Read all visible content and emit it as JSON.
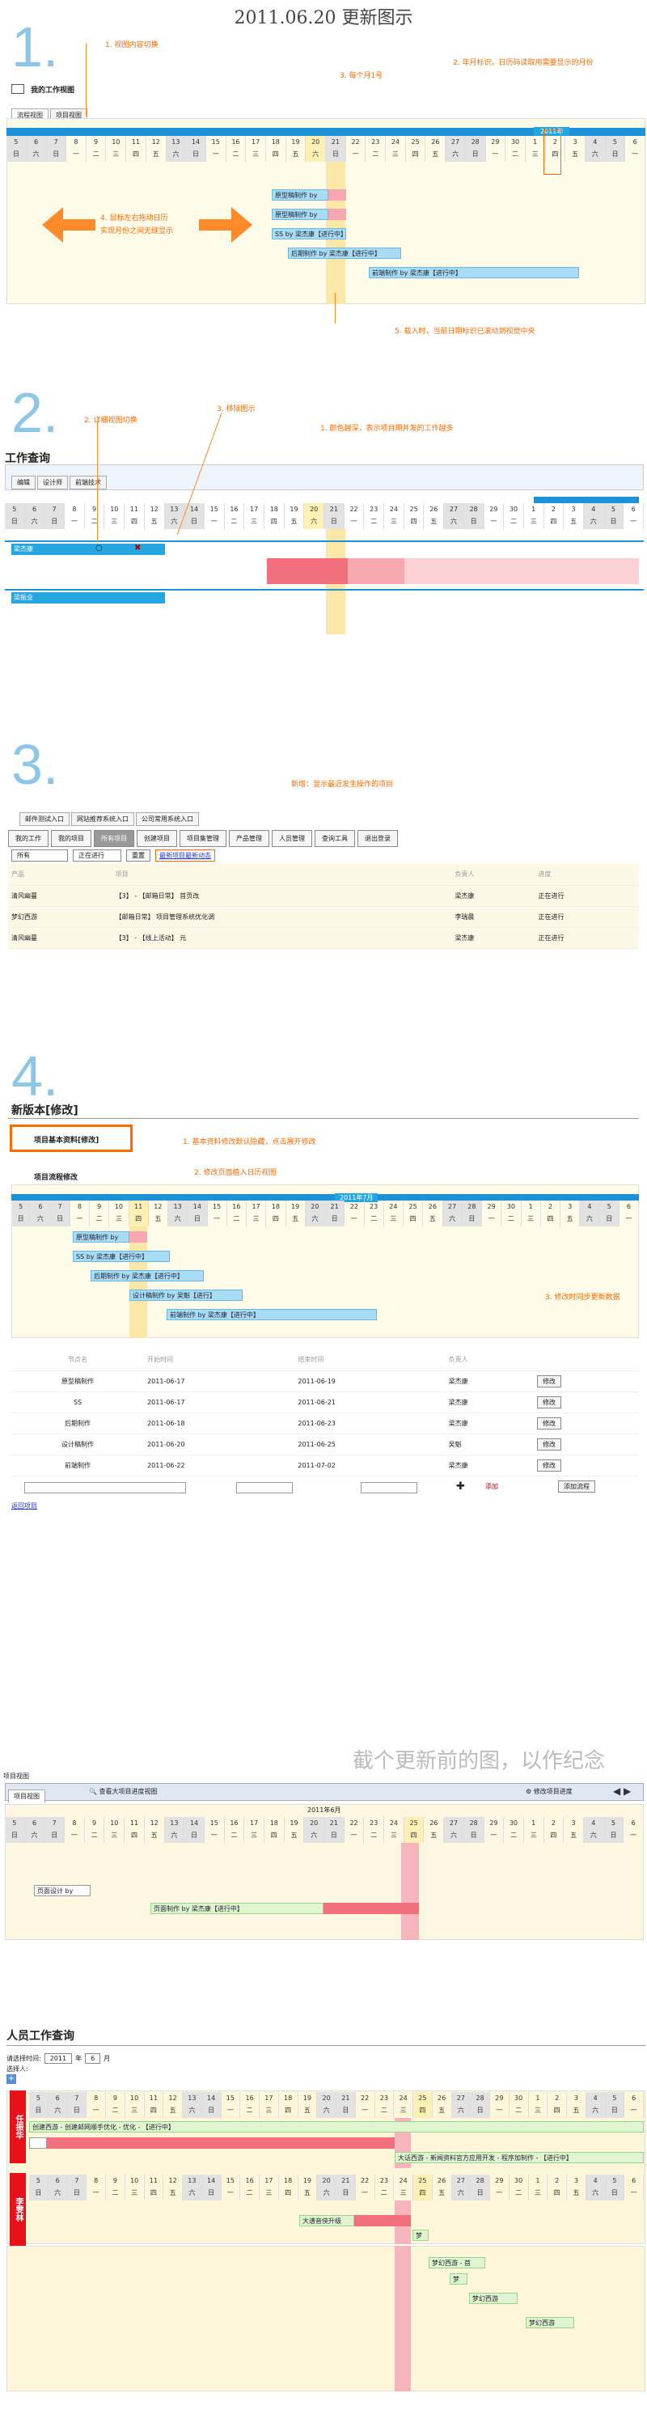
{
  "page_title": "2011.06.20 更新图示",
  "s1": {
    "num": "1.",
    "heading": "我的工作视图",
    "tabs": [
      "流程视图",
      "项目视图"
    ],
    "month_label": "2011年",
    "ann1": "1. 视图内容切换",
    "ann2": "2. 年月标识，日历码读取用需要显示的月份",
    "ann3": "3. 每个月1号",
    "ann4a": "4. 鼠标左右拖动日历",
    "ann4b": "实现月份之间无缝显示",
    "ann5": "5. 载入时，当前日期标识已滚动到视觉中央",
    "days": [
      "5",
      "6",
      "7",
      "8",
      "9",
      "10",
      "11",
      "12",
      "13",
      "14",
      "15",
      "16",
      "17",
      "18",
      "19",
      "20",
      "21",
      "22",
      "23",
      "24",
      "25",
      "26",
      "27",
      "28",
      "29",
      "30",
      "1",
      "2",
      "3",
      "4",
      "5",
      "6"
    ],
    "weekdays": [
      "日",
      "六",
      "日",
      "一",
      "二",
      "三",
      "四",
      "五",
      "六",
      "日",
      "一",
      "二",
      "三",
      "四",
      "五",
      "六",
      "日",
      "一",
      "二",
      "三",
      "四",
      "五",
      "六",
      "日",
      "一",
      "二",
      "三",
      "四",
      "五",
      "六",
      "日",
      "一"
    ],
    "bars": [
      "原型稿制作 by",
      "原型稿制作 by",
      "SS by 梁杰康【进行中】",
      "后期制作 by 梁杰康【进行中】",
      "前端制作 by 梁杰康【进行中】"
    ]
  },
  "s2": {
    "num": "2.",
    "heading": "工作查询",
    "tabs": [
      "编辑",
      "设计师",
      "前端技术"
    ],
    "ann1": "2. 详细视图切换",
    "ann2": "3. 移除图示",
    "ann3": "1. 颜色越深，表示项目期并发的工作越多",
    "rows": [
      "梁杰康",
      "梁振业"
    ]
  },
  "s3": {
    "num": "3.",
    "toptabs": [
      "邮件测试入口",
      "网站推荐系统入口",
      "公司常用系统入口"
    ],
    "tabs": [
      "我的工作",
      "我的项目",
      "所有项目",
      "创建项目",
      "项目集管理",
      "产品管理",
      "人员管理",
      "查询工具",
      "退出登录"
    ],
    "ann": "新增：显示最近发生操作的项目",
    "filter1": "所有",
    "filter2": "正在进行",
    "filter_btn": "重置",
    "recent_link": "最新项目最新动态",
    "cols": [
      "产品",
      "项目",
      "负责人",
      "进度"
    ],
    "rows": [
      [
        "清风幽蔓",
        "【3】 - 【邮箱日常】 首页改",
        "梁杰康",
        "正在进行"
      ],
      [
        "梦幻西游",
        "【邮箱日常】 项目管理系统优化调",
        "李瑞晨",
        "正在进行"
      ],
      [
        "清风幽蔓",
        "【3】 - 【线上活动】 元",
        "梁杰康",
        "正在进行"
      ]
    ]
  },
  "s4": {
    "num": "4.",
    "heading": "新版本[修改]",
    "box_label": "项目基本资料[修改]",
    "sub_label": "项目流程修改",
    "ann1": "1. 基本资料修改默认隐藏，点击展开修改",
    "ann2": "2. 修改页面植入日历视图",
    "ann3": "3. 修改时同步更新数据",
    "month_label": "2011年7月",
    "bars": [
      "原型稿制作 by",
      "SS by 梁杰康【进行中】",
      "后期制作 by 梁杰康【进行中】",
      "设计稿制作 by 吴魁【进行】",
      "前端制作 by 梁杰康【进行中】"
    ],
    "cols": [
      "节点名",
      "开始时间",
      "结束时间",
      "负责人"
    ],
    "rows": [
      [
        "原型稿制作",
        "2011-06-17",
        "2011-06-19",
        "梁杰康",
        "修改"
      ],
      [
        "SS",
        "2011-06-17",
        "2011-06-21",
        "梁杰康",
        "修改"
      ],
      [
        "后期制作",
        "2011-06-18",
        "2011-06-23",
        "梁杰康",
        "修改"
      ],
      [
        "设计稿制作",
        "2011-06-20",
        "2011-06-25",
        "吴魁",
        "修改"
      ],
      [
        "前端制作",
        "2011-06-22",
        "2011-07-02",
        "梁杰康",
        "修改"
      ]
    ],
    "add_label": "添加",
    "add_btn": "添加流程",
    "back_link": "返回项目"
  },
  "old": {
    "note": "截个更新前的图，以作纪念",
    "label": "项目视图",
    "tab": "项目视图",
    "search_link": "查看大项目进度视图",
    "settings_link": "修改项目进度",
    "month": "2011年6月",
    "bar1": "页面设计 by",
    "bar2": "页面制作 by 梁杰康【进行中】"
  },
  "work": {
    "heading": "人员工作查询",
    "time_label": "请选择时间:",
    "year": "2011",
    "month": "6",
    "year_unit": "年",
    "month_unit": "月",
    "person_label": "选择人:",
    "p1": "任振华",
    "p2": "李雯林",
    "bars": [
      "创建西游 - 创建邮网顺手优化 - 优化 - 【进行中】",
      "大话西游 - 新闻资料官方应用开发 - 程序加制作 - 【进行中】",
      "大谱音侠升级",
      "梦",
      "梦幻西游 - 首",
      "梦",
      "梦幻西游",
      "梦幻西游"
    ]
  }
}
